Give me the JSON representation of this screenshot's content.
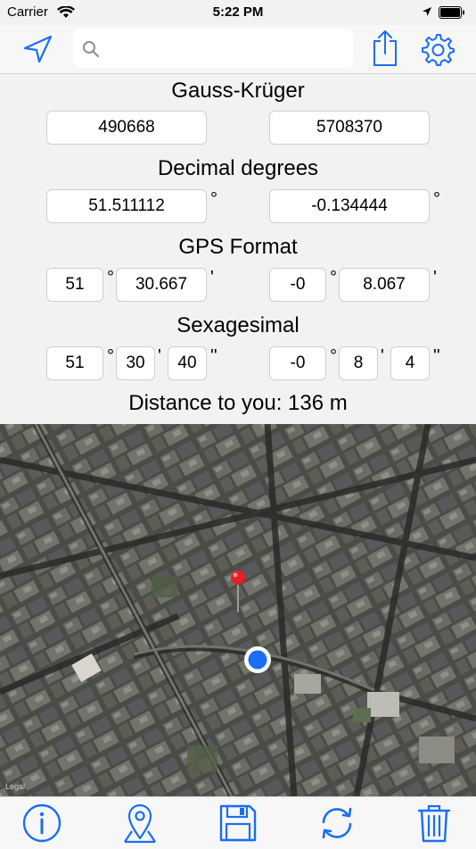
{
  "status_bar": {
    "carrier": "Carrier",
    "time": "5:22 PM"
  },
  "nav": {
    "search_placeholder": ""
  },
  "gauss_kruger": {
    "title": "Gauss-Krüger",
    "easting": "490668",
    "northing": "5708370"
  },
  "decimal_degrees": {
    "title": "Decimal degrees",
    "lat": "51.511112",
    "lat_unit": "°",
    "lon": "-0.134444",
    "lon_unit": "°"
  },
  "gps_format": {
    "title": "GPS Format",
    "lat_deg": "51",
    "lat_deg_unit": "°",
    "lat_min": "30.667",
    "lat_min_unit": "'",
    "lon_deg": "-0",
    "lon_deg_unit": "°",
    "lon_min": "8.067",
    "lon_min_unit": "'"
  },
  "sexagesimal": {
    "title": "Sexagesimal",
    "lat_deg": "51",
    "lat_deg_unit": "°",
    "lat_min": "30",
    "lat_min_unit": "'",
    "lat_sec": "40",
    "lat_sec_unit": "''",
    "lon_deg": "-0",
    "lon_deg_unit": "°",
    "lon_min": "8",
    "lon_min_unit": "'",
    "lon_sec": "4",
    "lon_sec_unit": "''"
  },
  "distance": {
    "text": "Distance to you: 136 m"
  },
  "map": {
    "legal": "Legal"
  },
  "colors": {
    "accent": "#1a6ef5",
    "pin": "#e0202a",
    "user_dot": "#1a6ef5"
  }
}
